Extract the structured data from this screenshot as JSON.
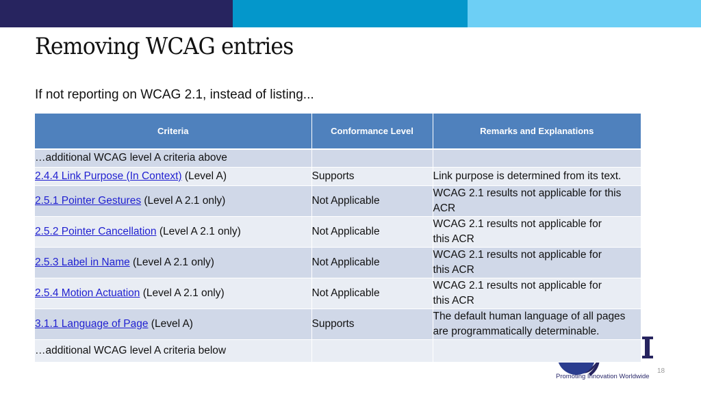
{
  "colors": {
    "topbar_dark": "#27245f",
    "topbar_mid": "#0497cb",
    "topbar_light": "#6dcff5",
    "header_bg": "#4f81bd",
    "row_dark": "#d0d8e8",
    "row_light": "#e9edf4",
    "link": "#1f1fd0"
  },
  "slide": {
    "title": "Removing WCAG entries",
    "subtitle": "If not reporting on WCAG 2.1, instead of listing...",
    "page_number": "18"
  },
  "logo": {
    "name": "ITI",
    "tagline": "Promoting Innovation Worldwide"
  },
  "table": {
    "headers": [
      "Criteria",
      "Conformance Level",
      "Remarks and Explanations"
    ],
    "rows": [
      {
        "criterion_link": "",
        "criterion_text": "…additional WCAG level A criteria above",
        "conformance": "",
        "remarks": ""
      },
      {
        "criterion_link": "2.4.4 Link Purpose (In Context)",
        "criterion_text": " (Level A)",
        "conformance": "Supports",
        "remarks": "Link purpose is determined from its text."
      },
      {
        "criterion_link": "2.5.1 Pointer Gestures",
        "criterion_text": " (Level A 2.1 only)",
        "conformance": "Not Applicable",
        "remarks": "WCAG 2.1 results not applicable for this ACR"
      },
      {
        "criterion_link": "2.5.2 Pointer Cancellation",
        "criterion_text": " (Level A 2.1 only)",
        "conformance": "Not Applicable",
        "remarks": "WCAG 2.1 results not applicable for this ACR"
      },
      {
        "criterion_link": "2.5.3 Label in Name",
        "criterion_text": " (Level A 2.1 only)",
        "conformance": "Not Applicable",
        "remarks": "WCAG 2.1 results not applicable for this ACR"
      },
      {
        "criterion_link": "2.5.4 Motion Actuation",
        "criterion_text": " (Level A 2.1 only)",
        "conformance": "Not Applicable",
        "remarks": "WCAG 2.1 results not applicable for this ACR"
      },
      {
        "criterion_link": "3.1.1 Language of Page",
        "criterion_text": " (Level A)",
        "conformance": "Supports",
        "remarks": "The default human language of all pages are programmatically determinable."
      },
      {
        "criterion_link": "",
        "criterion_text": "…additional WCAG level A criteria below",
        "conformance": "",
        "remarks": ""
      }
    ]
  }
}
